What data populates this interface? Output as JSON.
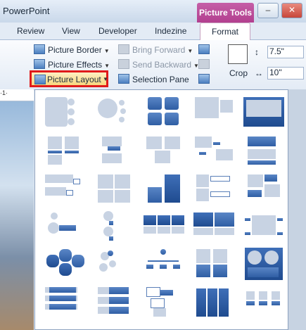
{
  "window": {
    "title": "PowerPoint",
    "context_tab": "Picture Tools"
  },
  "tabs": [
    "Review",
    "View",
    "Developer",
    "Indezine",
    "Format"
  ],
  "active_tab": "Format",
  "ribbon": {
    "picture_border": "Picture Border",
    "picture_effects": "Picture Effects",
    "picture_layout": "Picture Layout",
    "bring_forward": "Bring Forward",
    "send_backward": "Send Backward",
    "selection_pane": "Selection Pane",
    "crop": "Crop",
    "height_value": "7.5\"",
    "width_value": "10\""
  },
  "window_buttons": {
    "minimize": "–",
    "maximize": "□"
  },
  "ruler_text": "·1·",
  "accent_colors": {
    "highlight_border": "#e01a1a",
    "context_tab": "#b23f8f",
    "smartart_blue": "#2f5ea4"
  },
  "gallery": {
    "rows": 6,
    "cols": 5
  }
}
